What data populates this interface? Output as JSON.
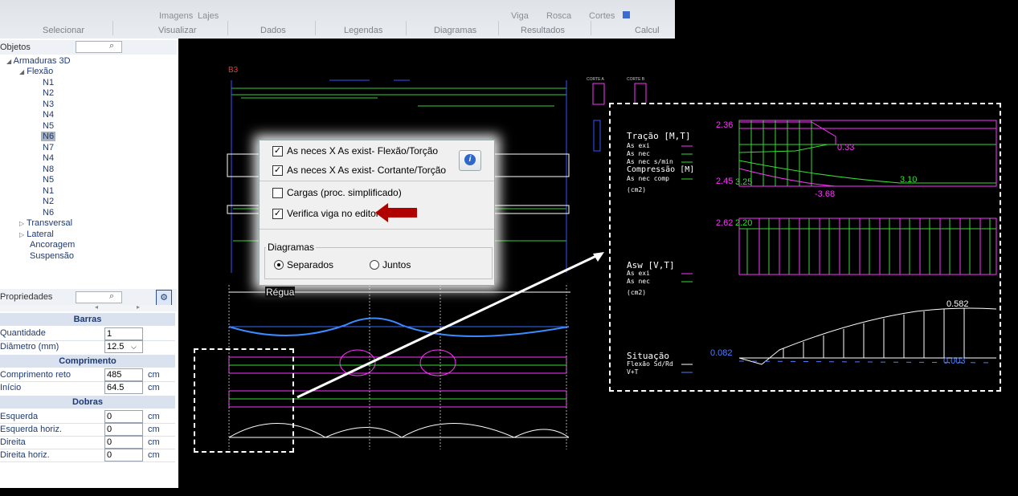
{
  "ribbon": {
    "top_items": [
      "Imagens",
      "Lajes",
      "Viga",
      "Rosca",
      "Cortes"
    ],
    "groups": [
      "Selecionar",
      "Visualizar",
      "Dados",
      "Legendas",
      "Diagramas",
      "Resultados",
      "Calcul"
    ]
  },
  "objects_panel": {
    "title": "Objetos",
    "search_placeholder": "",
    "tree": {
      "root": "Armaduras 3D",
      "flexao": "Flexão",
      "bars": [
        "N1",
        "N2",
        "N3",
        "N4",
        "N5",
        "N6",
        "N7",
        "N4",
        "N8",
        "N5",
        "N1",
        "N2",
        "N6"
      ],
      "selected_index": 5,
      "others": [
        "Transversal",
        "Lateral",
        "Ancoragem",
        "Suspensão"
      ]
    }
  },
  "properties_panel": {
    "title": "Propriedades",
    "sections": {
      "barras": "Barras",
      "comprimento": "Comprimento",
      "dobras": "Dobras"
    },
    "fields": {
      "quantidade_label": "Quantidade",
      "quantidade_value": "1",
      "diametro_label": "Diâmetro (mm)",
      "diametro_value": "12.5",
      "comp_reto_label": "Comprimento reto",
      "comp_reto_value": "485",
      "comp_reto_unit": "cm",
      "inicio_label": "Início",
      "inicio_value": "64.5",
      "inicio_unit": "cm",
      "esquerda_label": "Esquerda",
      "esquerda_value": "0",
      "esquerda_unit": "cm",
      "esq_horiz_label": "Esquerda horiz.",
      "esq_horiz_value": "0",
      "esq_horiz_unit": "cm",
      "direita_label": "Direita",
      "direita_value": "0",
      "direita_unit": "cm",
      "dir_horiz_label": "Direita horiz.",
      "dir_horiz_value": "0",
      "dir_horiz_unit": "cm"
    }
  },
  "dialog": {
    "opt1": "As neces X As exist- Flexão/Torção",
    "opt2": "As neces X As exist- Cortante/Torção",
    "opt3": "Cargas (proc. simplificado)",
    "opt4": "Verifica viga no editor",
    "checked": [
      true,
      true,
      false,
      true
    ],
    "diagramas_label": "Diagramas",
    "radio_separados": "Separados",
    "radio_juntos": "Juntos",
    "regua_label": "Régua"
  },
  "drawing": {
    "beam_label": "B3",
    "corte_a": "CORTE A",
    "corte_b": "CORTE B"
  },
  "zoom_panel": {
    "tracao_title": "Tração [M,T]",
    "tracao_legend": [
      "As exi",
      "As nec",
      "As nec s/min"
    ],
    "compressao_title": "Compressão [M]",
    "compressao_legend": [
      "As nec comp"
    ],
    "unit1": "(cm2)",
    "v_2_36": "2.36",
    "v_0_33": "0.33",
    "v_2_45": "2.45",
    "v_3_25": "3.25",
    "v_3_10": "3.10",
    "v_neg_3_68": "-3.68",
    "v_2_62": "2.62",
    "v_2_20": "2.20",
    "asw_title": "Asw [V,T]",
    "asw_legend": [
      "As exi",
      "As nec"
    ],
    "unit2": "(cm2)",
    "v_0_582": "0.582",
    "v_0_082": "0.082",
    "v_0_003": "0.003",
    "situacao_title": "Situação",
    "situacao_legend": [
      "Flexão Sd/Rd",
      "V+T"
    ]
  },
  "colors": {
    "magenta": "#ff33ff",
    "green": "#33dd33",
    "blue": "#3a6bff",
    "arrow_red": "#b00000"
  }
}
